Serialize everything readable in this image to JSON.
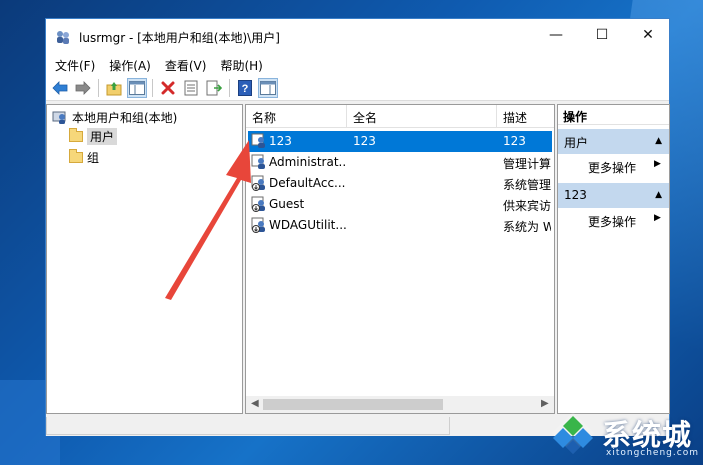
{
  "window": {
    "title": "lusrmgr - [本地用户和组(本地)\\用户]",
    "minimize": "—",
    "maximize": "☐",
    "close": "✕"
  },
  "menu": [
    "文件(F)",
    "操作(A)",
    "查看(V)",
    "帮助(H)"
  ],
  "toolbar_icons": [
    "back-icon",
    "forward-icon",
    "up-folder-icon",
    "show-hide-tree-icon",
    "delete-icon",
    "properties-icon",
    "export-icon",
    "help-icon",
    "show-hide-action-pane-icon"
  ],
  "tree": {
    "root": "本地用户和组(本地)",
    "children": [
      "用户",
      "组"
    ],
    "selected": "用户"
  },
  "list": {
    "columns": [
      "名称",
      "全名",
      "描述"
    ],
    "rows": [
      {
        "name": "123",
        "full_name": "123",
        "description": "123",
        "selected": true
      },
      {
        "name": "Administrat...",
        "full_name": "",
        "description": "管理计算"
      },
      {
        "name": "DefaultAcc...",
        "full_name": "",
        "description": "系统管理"
      },
      {
        "name": "Guest",
        "full_name": "",
        "description": "供来宾访"
      },
      {
        "name": "WDAGUtilit...",
        "full_name": "",
        "description": "系统为 W"
      }
    ]
  },
  "actions": {
    "title": "操作",
    "sections": [
      {
        "header": "用户",
        "link": "更多操作"
      },
      {
        "header": "123",
        "link": "更多操作"
      }
    ]
  },
  "watermark": {
    "name": "系统城",
    "url": "xitongcheng.com"
  },
  "colors": {
    "selection": "#0078d7",
    "action_header_bg": "#c3d8ee",
    "annotation_arrow": "#e8463a"
  }
}
